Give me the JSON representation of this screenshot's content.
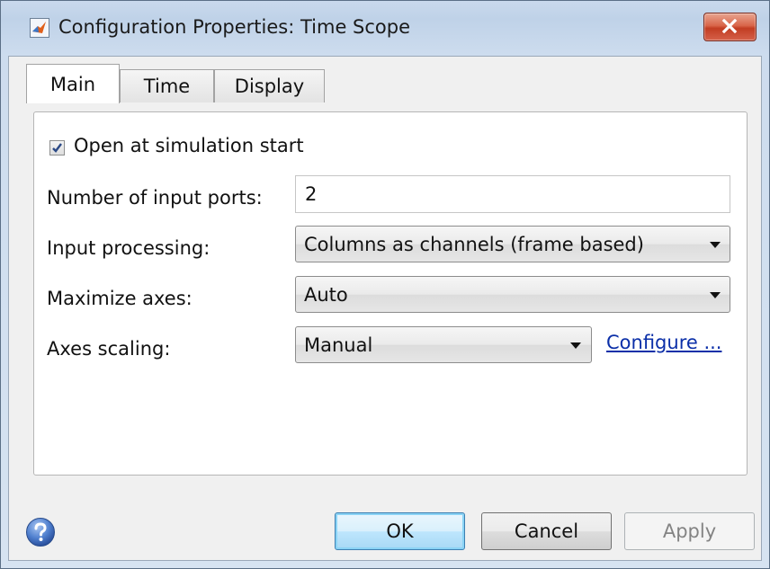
{
  "window": {
    "title": "Configuration Properties: Time Scope"
  },
  "tabs": [
    {
      "label": "Main",
      "active": true
    },
    {
      "label": "Time",
      "active": false
    },
    {
      "label": "Display",
      "active": false
    }
  ],
  "main": {
    "open_at_start": {
      "label": "Open at simulation start",
      "checked": true
    },
    "num_ports": {
      "label": "Number of input ports:",
      "value": "2"
    },
    "input_processing": {
      "label": "Input processing:",
      "value": "Columns as channels (frame based)"
    },
    "maximize_axes": {
      "label": "Maximize axes:",
      "value": "Auto"
    },
    "axes_scaling": {
      "label": "Axes scaling:",
      "value": "Manual",
      "configure_link": "Configure ..."
    }
  },
  "buttons": {
    "ok": "OK",
    "cancel": "Cancel",
    "apply": "Apply"
  },
  "colors": {
    "link": "#0b2fa8",
    "close_button": "#c23d22",
    "default_button": "#bee6fd"
  }
}
